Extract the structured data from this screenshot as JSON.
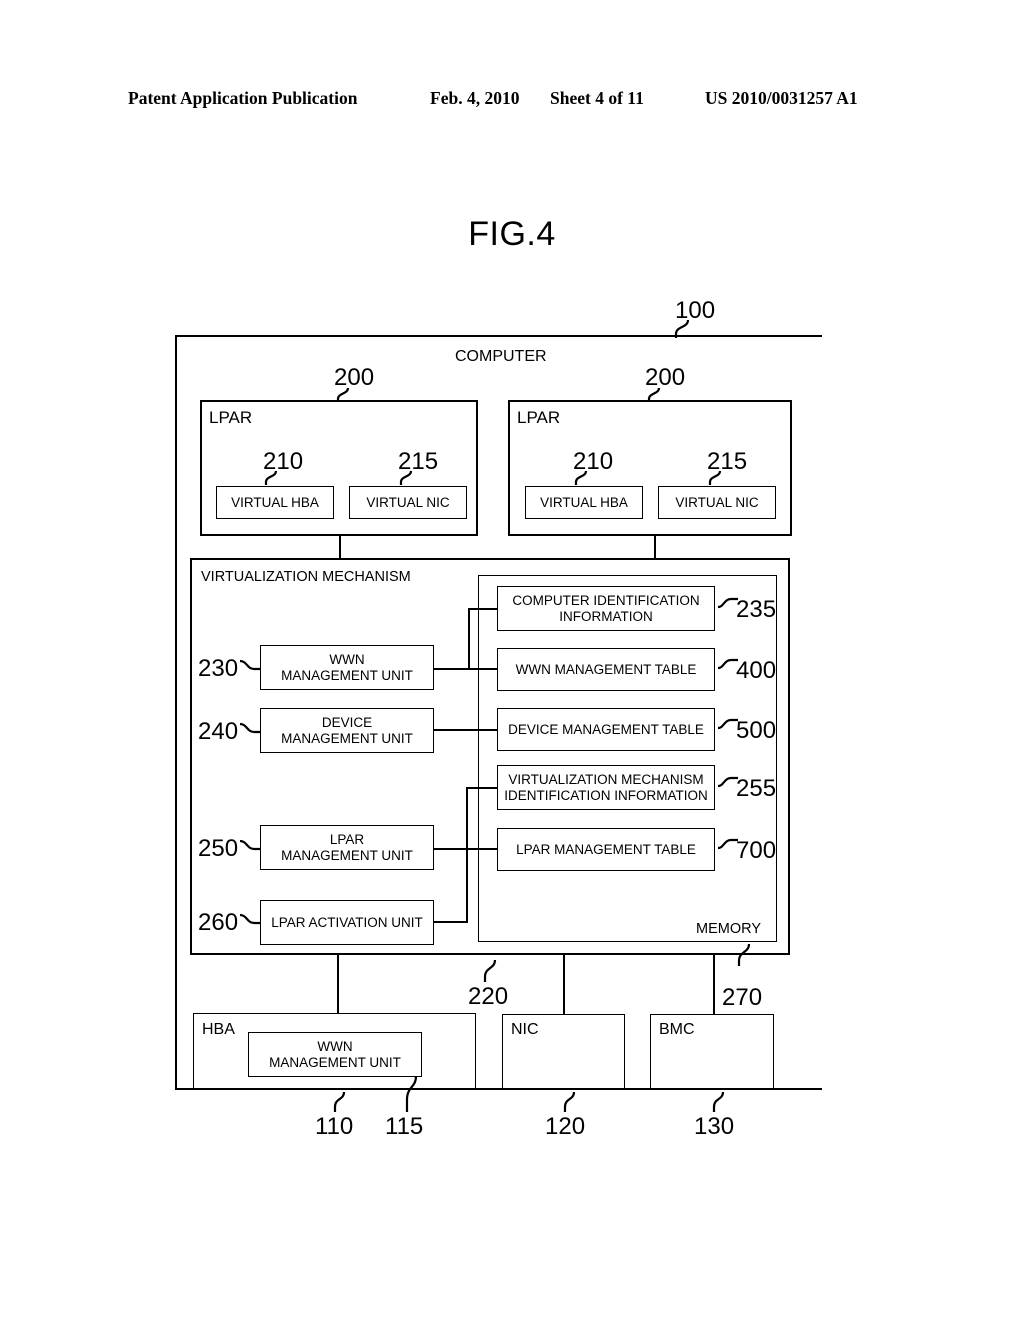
{
  "header": {
    "publication": "Patent Application Publication",
    "date": "Feb. 4, 2010",
    "sheet": "Sheet 4 of 11",
    "docnum": "US 2010/0031257 A1"
  },
  "figure": {
    "title": "FIG.4"
  },
  "diagram": {
    "computer": {
      "label": "COMPUTER",
      "ref": "100"
    },
    "lpars": [
      {
        "label": "LPAR",
        "ref": "200",
        "children": [
          {
            "label": "VIRTUAL HBA",
            "ref": "210"
          },
          {
            "label": "VIRTUAL NIC",
            "ref": "215"
          }
        ]
      },
      {
        "label": "LPAR",
        "ref": "200",
        "children": [
          {
            "label": "VIRTUAL HBA",
            "ref": "210"
          },
          {
            "label": "VIRTUAL NIC",
            "ref": "215"
          }
        ]
      }
    ],
    "virtualization_mechanism": {
      "label": "VIRTUALIZATION MECHANISM",
      "ref": "220",
      "units": [
        {
          "label": "WWN\nMANAGEMENT UNIT",
          "line1": "WWN",
          "line2": "MANAGEMENT UNIT",
          "ref": "230"
        },
        {
          "label": "DEVICE\nMANAGEMENT UNIT",
          "line1": "DEVICE",
          "line2": "MANAGEMENT UNIT",
          "ref": "240"
        },
        {
          "label": "LPAR\nMANAGEMENT UNIT",
          "line1": "LPAR",
          "line2": "MANAGEMENT UNIT",
          "ref": "250"
        },
        {
          "label": "LPAR ACTIVATION UNIT",
          "line1": "LPAR ACTIVATION UNIT",
          "line2": "",
          "ref": "260"
        }
      ]
    },
    "memory": {
      "label": "MEMORY",
      "ref": "270",
      "items": [
        {
          "line1": "COMPUTER IDENTIFICATION",
          "line2": "INFORMATION",
          "ref": "235"
        },
        {
          "line1": "WWN MANAGEMENT TABLE",
          "line2": "",
          "ref": "400"
        },
        {
          "line1": "DEVICE MANAGEMENT TABLE",
          "line2": "",
          "ref": "500"
        },
        {
          "line1": "VIRTUALIZATION MECHANISM",
          "line2": "IDENTIFICATION INFORMATION",
          "ref": "255"
        },
        {
          "line1": "LPAR MANAGEMENT TABLE",
          "line2": "",
          "ref": "700"
        }
      ]
    },
    "devices": [
      {
        "label": "HBA",
        "ref": "110",
        "inner": {
          "line1": "WWN",
          "line2": "MANAGEMENT UNIT",
          "ref": "115"
        }
      },
      {
        "label": "NIC",
        "ref": "120",
        "inner": null
      },
      {
        "label": "BMC",
        "ref": "130",
        "inner": null
      }
    ]
  }
}
